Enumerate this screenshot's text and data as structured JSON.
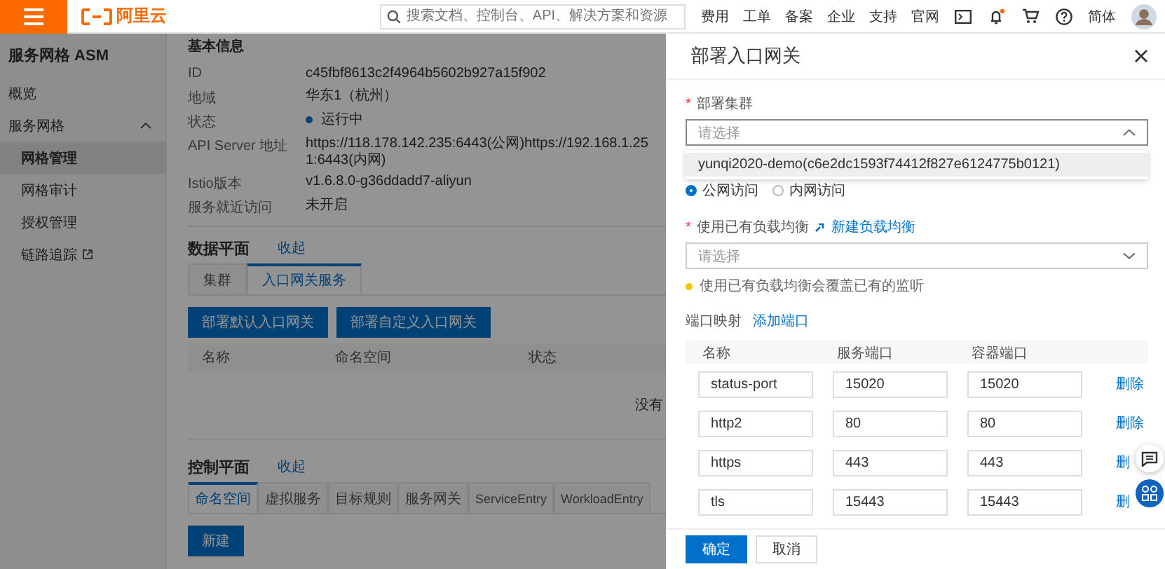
{
  "topbar": {
    "logo_text": "阿里云",
    "search": {
      "placeholder": "搜索文档、控制台、API、解决方案和资源"
    },
    "nav": [
      "费用",
      "工单",
      "备案",
      "企业",
      "支持",
      "官网"
    ],
    "notification_dot": true,
    "language": "简体"
  },
  "sidebar": {
    "title": "服务网格 ASM",
    "items": [
      {
        "label": "概览",
        "selected": false
      },
      {
        "label": "服务网格",
        "selected": false,
        "expanded": true,
        "children": [
          {
            "label": "网格管理",
            "selected": true,
            "external": false
          },
          {
            "label": "网格审计",
            "selected": false,
            "external": false
          },
          {
            "label": "授权管理",
            "selected": false,
            "external": false
          },
          {
            "label": "链路追踪",
            "selected": false,
            "external": true
          }
        ]
      }
    ]
  },
  "basic_info": {
    "title": "基本信息",
    "rows": [
      {
        "kind": "text",
        "label": "ID",
        "value": "c45fbf8613c2f4964b5602b927a15f902"
      },
      {
        "kind": "text",
        "label": "地域",
        "value": "华东1（杭州）"
      },
      {
        "kind": "status",
        "label": "状态",
        "value": "运行中"
      },
      {
        "kind": "text",
        "label": "API Server 地址",
        "value": "https://118.178.142.235:6443(公网)https://192.168.1.251:6443(内网)"
      },
      {
        "kind": "text",
        "label": "Istio版本",
        "value": "v1.6.8.0-g36ddadd7-aliyun"
      },
      {
        "kind": "text",
        "label": "服务就近访问",
        "value": "未开启"
      }
    ]
  },
  "data_plane": {
    "title": "数据平面",
    "toggle": "收起",
    "tabs": [
      {
        "label": "集群",
        "selected": false
      },
      {
        "label": "入口网关服务",
        "selected": true
      }
    ],
    "buttons": [
      "部署默认入口网关",
      "部署自定义入口网关"
    ],
    "columns": [
      "名称",
      "命名空间",
      "状态"
    ],
    "empty_text": "没有"
  },
  "control_plane": {
    "title": "控制平面",
    "toggle": "收起",
    "tabs": [
      {
        "label": "命名空间",
        "selected": true
      },
      {
        "label": "虚拟服务",
        "selected": false
      },
      {
        "label": "目标规则",
        "selected": false
      },
      {
        "label": "服务网关",
        "selected": false
      },
      {
        "label": "ServiceEntry",
        "selected": false
      },
      {
        "label": "WorkloadEntry",
        "selected": false
      }
    ],
    "button": "新建"
  },
  "drawer": {
    "title": "部署入口网关",
    "cluster": {
      "required_mark": "*",
      "label": "部署集群",
      "placeholder": "请选择",
      "expanded": true,
      "options": [
        {
          "label": "yunqi2020-demo(c6e2dc1593f74412f827e6124775b0121)",
          "hovered": true
        }
      ]
    },
    "access": [
      {
        "label": "公网访问",
        "selected": true
      },
      {
        "label": "内网访问",
        "selected": false
      }
    ],
    "load_balancer": {
      "required_mark": "*",
      "label": "使用已有负载均衡",
      "link": "新建负载均衡",
      "placeholder": "请选择",
      "warning": "使用已有负载均衡会覆盖已有的监听"
    },
    "ports": {
      "label": "端口映射",
      "link": "添加端口",
      "columns": [
        "名称",
        "服务端口",
        "容器端口"
      ],
      "rows": [
        {
          "name": "status-port",
          "service_port": "15020",
          "container_port": "15020",
          "action": "删除"
        },
        {
          "name": "http2",
          "service_port": "80",
          "container_port": "80",
          "action": "删除"
        },
        {
          "name": "https",
          "service_port": "443",
          "container_port": "443",
          "action": "删"
        },
        {
          "name": "tls",
          "service_port": "15443",
          "container_port": "15443",
          "action": "删"
        }
      ]
    },
    "buttons": [
      {
        "label": "确定",
        "primary": true
      },
      {
        "label": "取消",
        "primary": false
      }
    ]
  }
}
